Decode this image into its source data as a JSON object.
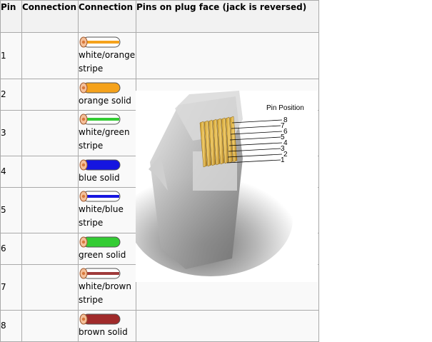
{
  "table": {
    "headers": {
      "pin": "Pin",
      "connection1": "Connection",
      "connection2": "Connection",
      "plug_face": "Pins on plug face (jack is reversed)"
    },
    "rows": [
      {
        "pin": "1",
        "line1": "white/orange",
        "line2": "stripe",
        "base": "#ffffff",
        "stripe": "#f5a21b",
        "cut": "#f4c09a"
      },
      {
        "pin": "2",
        "line1": "orange solid",
        "line2": "",
        "base": "#f5a21b",
        "stripe": "",
        "cut": "#f4c09a"
      },
      {
        "pin": "3",
        "line1": "white/green",
        "line2": "stripe",
        "base": "#ffffff",
        "stripe": "#33cc33",
        "cut": "#f4c09a"
      },
      {
        "pin": "4",
        "line1": "blue solid",
        "line2": "",
        "base": "#1515e0",
        "stripe": "",
        "cut": "#f4c09a"
      },
      {
        "pin": "5",
        "line1": "white/blue",
        "line2": "stripe",
        "base": "#ffffff",
        "stripe": "#1515e0",
        "cut": "#f4c09a"
      },
      {
        "pin": "6",
        "line1": "green solid",
        "line2": "",
        "base": "#33cc33",
        "stripe": "",
        "cut": "#f4c09a"
      },
      {
        "pin": "7",
        "line1": "white/brown",
        "line2": "stripe",
        "base": "#ffffff",
        "stripe": "#a03a3a",
        "cut": "#f4c09a"
      },
      {
        "pin": "8",
        "line1": "brown solid",
        "line2": "",
        "base": "#a02a2a",
        "stripe": "",
        "cut": "#f4c09a"
      }
    ]
  },
  "plug_image": {
    "title": "Pin Position",
    "pins": [
      "8",
      "7",
      "6",
      "5",
      "4",
      "3",
      "2",
      "1"
    ]
  }
}
